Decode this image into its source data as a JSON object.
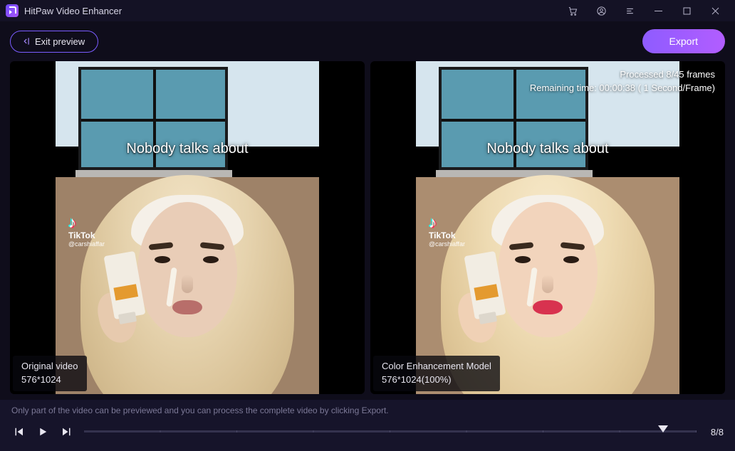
{
  "app": {
    "title": "HitPaw Video Enhancer"
  },
  "toolbar": {
    "exit_preview_label": "Exit preview",
    "export_label": "Export"
  },
  "panels": {
    "left": {
      "title": "Original video",
      "resolution": "576*1024",
      "caption": "Nobody talks about",
      "watermark_brand": "TikTok",
      "watermark_handle": "@carshiaffar"
    },
    "right": {
      "title": "Color Enhancement Model",
      "resolution": "576*1024(100%)",
      "caption": "Nobody talks about",
      "watermark_brand": "TikTok",
      "watermark_handle": "@carshiaffar",
      "status_line1": "Processed 8/45 frames",
      "status_line2": "Remaining time: 00:00:38 ( 1 Second/Frame)"
    }
  },
  "footer": {
    "hint": "Only part of the video can be previewed and you can process the complete video by clicking Export.",
    "frame_counter": "8/8"
  },
  "processing": {
    "processed_frames": 8,
    "total_frames": 45,
    "remaining_seconds": 38,
    "seconds_per_frame": 1
  },
  "colors": {
    "accent": "#8e5cff",
    "bg": "#0f0d1b"
  }
}
